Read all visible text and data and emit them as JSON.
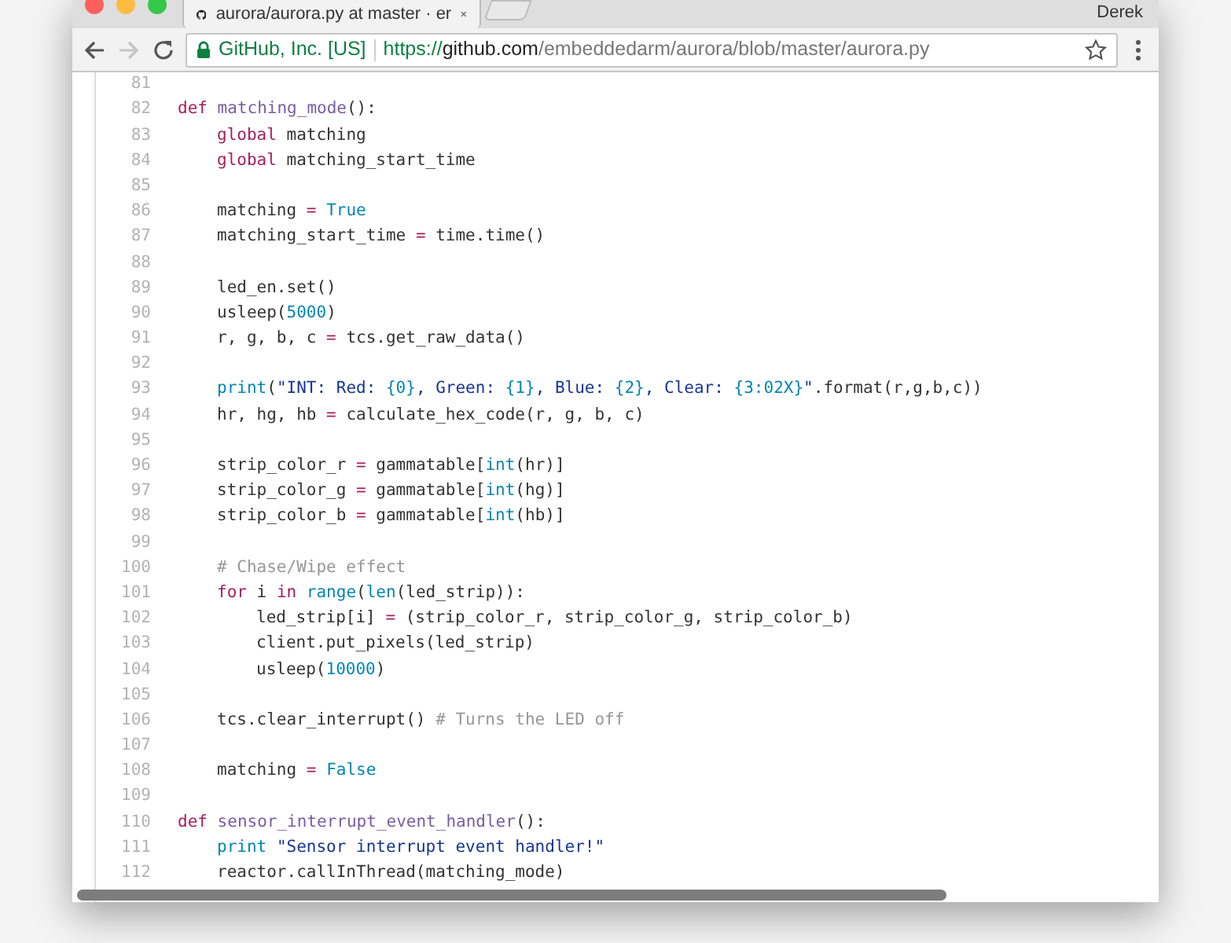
{
  "browser": {
    "tab_title": "aurora/aurora.py at master · er",
    "profile_name": "Derek",
    "forward_disabled": true,
    "address": {
      "security_label": "GitHub, Inc. [US]",
      "scheme": "https://",
      "host": "github.com",
      "path": "/embeddedarm/aurora/blob/master/aurora.py"
    }
  },
  "code": {
    "lines": [
      {
        "number": "81"
      },
      {
        "number": "82",
        "kind": "top",
        "tokens": [
          {
            "kind": "keyword",
            "text": "def "
          },
          {
            "kind": "entity",
            "text": "matching_mode"
          },
          {
            "kind": "plain",
            "text": "():"
          }
        ]
      },
      {
        "number": "83",
        "kind": "body",
        "tokens": [
          {
            "kind": "keyword",
            "text": "global"
          },
          {
            "kind": "plain",
            "text": " matching"
          }
        ]
      },
      {
        "number": "84",
        "kind": "body",
        "tokens": [
          {
            "kind": "keyword",
            "text": "global"
          },
          {
            "kind": "plain",
            "text": " matching_start_time"
          }
        ]
      },
      {
        "number": "85"
      },
      {
        "number": "86",
        "kind": "body",
        "tokens": [
          {
            "kind": "plain",
            "text": "matching "
          },
          {
            "kind": "operator",
            "text": "= "
          },
          {
            "kind": "constant",
            "text": "True"
          }
        ]
      },
      {
        "number": "87",
        "kind": "body",
        "tokens": [
          {
            "kind": "plain",
            "text": "matching_start_time "
          },
          {
            "kind": "operator",
            "text": "="
          },
          {
            "kind": "plain",
            "text": " time.time()"
          }
        ]
      },
      {
        "number": "88"
      },
      {
        "number": "89",
        "kind": "body",
        "tokens": [
          {
            "kind": "plain",
            "text": "led_en.set()"
          }
        ]
      },
      {
        "number": "90",
        "kind": "body",
        "tokens": [
          {
            "kind": "plain",
            "text": "usleep("
          },
          {
            "kind": "constant",
            "text": "5000"
          },
          {
            "kind": "plain",
            "text": ")"
          }
        ]
      },
      {
        "number": "91",
        "kind": "body",
        "tokens": [
          {
            "kind": "plain",
            "text": "r, g, b, c "
          },
          {
            "kind": "operator",
            "text": "="
          },
          {
            "kind": "plain",
            "text": " tcs.get_raw_data()"
          }
        ]
      },
      {
        "number": "92"
      },
      {
        "number": "93",
        "kind": "body",
        "tokens": [
          {
            "kind": "constant",
            "text": "print"
          },
          {
            "kind": "plain",
            "text": "("
          },
          {
            "kind": "string",
            "text": "\"INT: Red: "
          },
          {
            "kind": "constant",
            "text": "{0}"
          },
          {
            "kind": "string",
            "text": ", Green: "
          },
          {
            "kind": "constant",
            "text": "{1}"
          },
          {
            "kind": "string",
            "text": ", Blue: "
          },
          {
            "kind": "constant",
            "text": "{2}"
          },
          {
            "kind": "string",
            "text": ", Clear: "
          },
          {
            "kind": "constant",
            "text": "{3:02X}"
          },
          {
            "kind": "string",
            "text": "\""
          },
          {
            "kind": "plain",
            "text": ".format(r,g,b,c))"
          }
        ]
      },
      {
        "number": "94",
        "kind": "body",
        "tokens": [
          {
            "kind": "plain",
            "text": "hr, hg, hb "
          },
          {
            "kind": "operator",
            "text": "="
          },
          {
            "kind": "plain",
            "text": " calculate_hex_code(r, g, b, c)"
          }
        ]
      },
      {
        "number": "95"
      },
      {
        "number": "96",
        "kind": "body",
        "tokens": [
          {
            "kind": "plain",
            "text": "strip_color_r "
          },
          {
            "kind": "operator",
            "text": "="
          },
          {
            "kind": "plain",
            "text": " gammatable["
          },
          {
            "kind": "constant",
            "text": "int"
          },
          {
            "kind": "plain",
            "text": "(hr)]"
          }
        ]
      },
      {
        "number": "97",
        "kind": "body",
        "tokens": [
          {
            "kind": "plain",
            "text": "strip_color_g "
          },
          {
            "kind": "operator",
            "text": "="
          },
          {
            "kind": "plain",
            "text": " gammatable["
          },
          {
            "kind": "constant",
            "text": "int"
          },
          {
            "kind": "plain",
            "text": "(hg)]"
          }
        ]
      },
      {
        "number": "98",
        "kind": "body",
        "tokens": [
          {
            "kind": "plain",
            "text": "strip_color_b "
          },
          {
            "kind": "operator",
            "text": "="
          },
          {
            "kind": "plain",
            "text": " gammatable["
          },
          {
            "kind": "constant",
            "text": "int"
          },
          {
            "kind": "plain",
            "text": "(hb)]"
          }
        ]
      },
      {
        "number": "99"
      },
      {
        "number": "100",
        "kind": "body",
        "tokens": [
          {
            "kind": "comment",
            "text": "# Chase/Wipe effect"
          }
        ]
      },
      {
        "number": "101",
        "kind": "body",
        "tokens": [
          {
            "kind": "keyword",
            "text": "for"
          },
          {
            "kind": "plain",
            "text": " i "
          },
          {
            "kind": "keyword",
            "text": "in "
          },
          {
            "kind": "constant",
            "text": "range"
          },
          {
            "kind": "plain",
            "text": "("
          },
          {
            "kind": "constant",
            "text": "len"
          },
          {
            "kind": "plain",
            "text": "(led_strip)):"
          }
        ]
      },
      {
        "number": "102",
        "kind": "nested",
        "tokens": [
          {
            "kind": "plain",
            "text": "led_strip[i] "
          },
          {
            "kind": "operator",
            "text": "="
          },
          {
            "kind": "plain",
            "text": " (strip_color_r, strip_color_g, strip_color_b)"
          }
        ]
      },
      {
        "number": "103",
        "kind": "nested",
        "tokens": [
          {
            "kind": "plain",
            "text": "client.put_pixels(led_strip)"
          }
        ]
      },
      {
        "number": "104",
        "kind": "nested",
        "tokens": [
          {
            "kind": "plain",
            "text": "usleep("
          },
          {
            "kind": "constant",
            "text": "10000"
          },
          {
            "kind": "plain",
            "text": ")"
          }
        ]
      },
      {
        "number": "105"
      },
      {
        "number": "106",
        "kind": "body",
        "tokens": [
          {
            "kind": "plain",
            "text": "tcs.clear_interrupt() "
          },
          {
            "kind": "comment",
            "text": "# Turns the LED off"
          }
        ]
      },
      {
        "number": "107"
      },
      {
        "number": "108",
        "kind": "body",
        "tokens": [
          {
            "kind": "plain",
            "text": "matching "
          },
          {
            "kind": "operator",
            "text": "= "
          },
          {
            "kind": "constant",
            "text": "False"
          }
        ]
      },
      {
        "number": "109"
      },
      {
        "number": "110",
        "kind": "top",
        "tokens": [
          {
            "kind": "keyword",
            "text": "def "
          },
          {
            "kind": "entity",
            "text": "sensor_interrupt_event_handler"
          },
          {
            "kind": "plain",
            "text": "():"
          }
        ]
      },
      {
        "number": "111",
        "kind": "body",
        "tokens": [
          {
            "kind": "constant",
            "text": "print "
          },
          {
            "kind": "string",
            "text": "\"Sensor interrupt event handler!\""
          }
        ]
      },
      {
        "number": "112",
        "kind": "body",
        "tokens": [
          {
            "kind": "plain",
            "text": "reactor.callInThread(matching_mode)"
          }
        ]
      }
    ]
  }
}
